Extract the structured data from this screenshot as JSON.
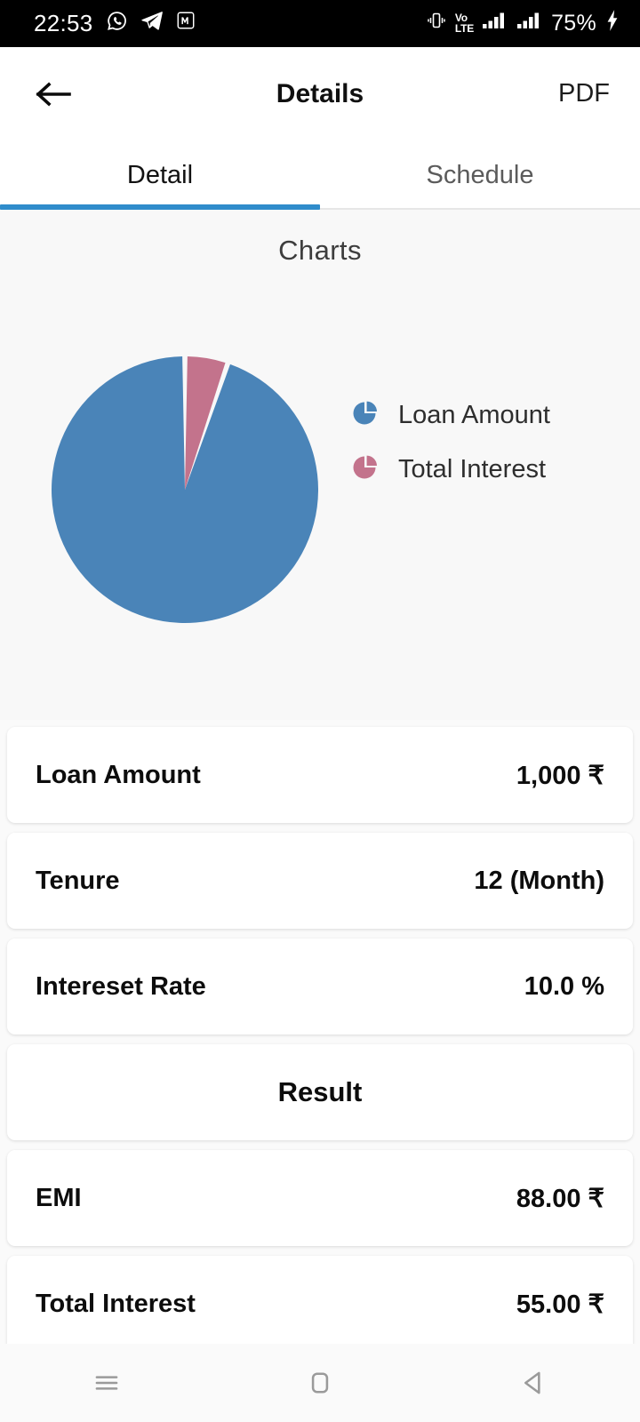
{
  "statusbar": {
    "clock": "22:53",
    "battery_percent": "75%",
    "volte_top": "Vo",
    "volte_bottom": "LTE",
    "icons": [
      "whatsapp-icon",
      "telegram-icon",
      "m-app-icon",
      "vibrate-icon",
      "volte-icon",
      "signal-sim1-icon",
      "signal-sim2-icon",
      "charging-bolt-icon"
    ]
  },
  "appbar": {
    "back_icon": "arrow-left-icon",
    "title": "Details",
    "pdf_label": "PDF"
  },
  "tabs": {
    "items": [
      {
        "label": "Detail",
        "active": true
      },
      {
        "label": "Schedule",
        "active": false
      }
    ],
    "indicator_color": "#2f8ccb"
  },
  "chart": {
    "title": "Charts",
    "legend": [
      {
        "label": "Loan Amount",
        "color": "#4a84b8",
        "icon": "pie-chart-icon"
      },
      {
        "label": "Total Interest",
        "color": "#c3738c",
        "icon": "pie-chart-icon"
      }
    ]
  },
  "chart_data": {
    "type": "pie",
    "title": "Charts",
    "categories": [
      "Loan Amount",
      "Total Interest"
    ],
    "values": [
      1000,
      55
    ],
    "percents": [
      94.8,
      5.2
    ],
    "colors": [
      "#4a84b8",
      "#c3738c"
    ],
    "start_angle_deg": 270,
    "direction": "counterclockwise",
    "legend_position": "right",
    "grid": false,
    "xlabel": "",
    "ylabel": ""
  },
  "details": {
    "rows": [
      {
        "label": "Loan Amount",
        "value": "1,000 ₹",
        "center": false
      },
      {
        "label": "Tenure",
        "value": "12 (Month)",
        "center": false
      },
      {
        "label": "Intereset Rate",
        "value": "10.0 %",
        "center": false
      },
      {
        "label": "Result",
        "value": "",
        "center": true
      },
      {
        "label": "EMI",
        "value": "88.00 ₹",
        "center": false
      },
      {
        "label": "Total Interest",
        "value": "55.00 ₹",
        "center": false
      }
    ]
  },
  "navbar": {
    "items": [
      {
        "name": "recents-icon"
      },
      {
        "name": "home-icon"
      },
      {
        "name": "back-icon"
      }
    ]
  }
}
